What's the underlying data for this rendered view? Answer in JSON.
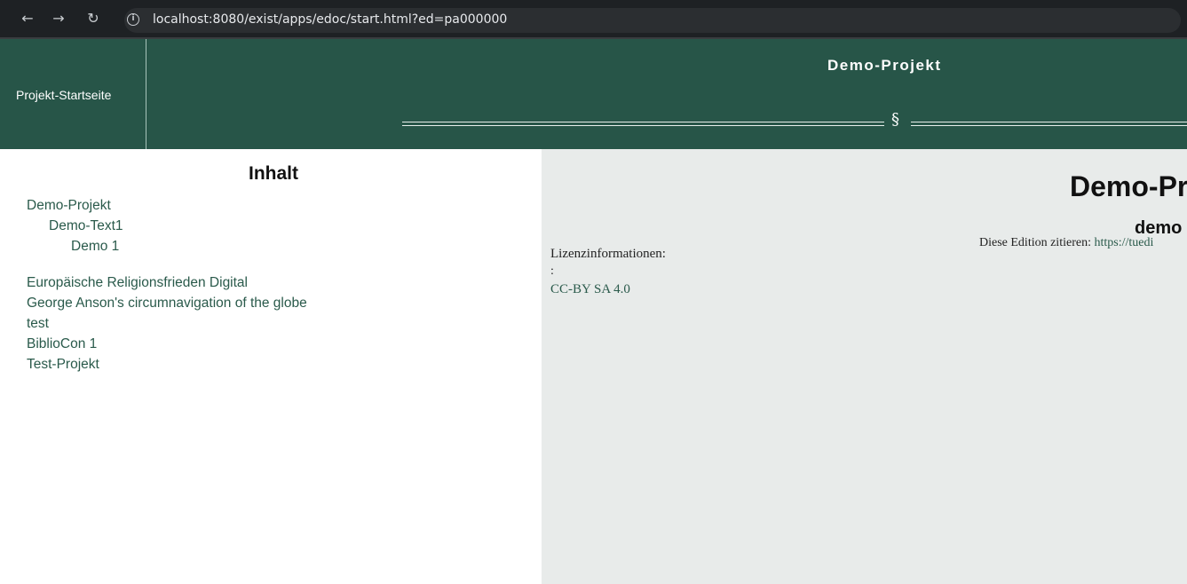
{
  "browser": {
    "back_icon": "arrow-left-icon",
    "forward_icon": "arrow-right-icon",
    "reload_icon": "reload-icon",
    "info_icon": "info-icon",
    "url": "localhost:8080/exist/apps/edoc/start.html?ed=pa000000"
  },
  "header": {
    "home_label": "Projekt-Startseite",
    "project_title": "Demo-Projekt",
    "divider_symbol": "§",
    "background_color": "#275548"
  },
  "toc": {
    "heading": "Inhalt",
    "items": [
      {
        "label": "Demo-Projekt"
      },
      {
        "label": "Demo-Text1"
      },
      {
        "label": "Demo 1"
      },
      {
        "label": "Europäische Religionsfrieden Digital"
      },
      {
        "label": "George Anson's circumnavigation of the globe"
      },
      {
        "label": "test"
      },
      {
        "label": "BiblioCon 1"
      },
      {
        "label": "Test-Projekt"
      }
    ],
    "link_color": "#2a5a4b"
  },
  "content": {
    "title": "Demo-Pr",
    "subtitle": "demo",
    "cite_label": "Diese Edition zitieren:",
    "cite_link": "https://tuedi",
    "license_label": "Lizenzinformationen:",
    "license_colon": ":",
    "license_link": "CC-BY SA 4.0",
    "background_color": "#e8ebea"
  }
}
